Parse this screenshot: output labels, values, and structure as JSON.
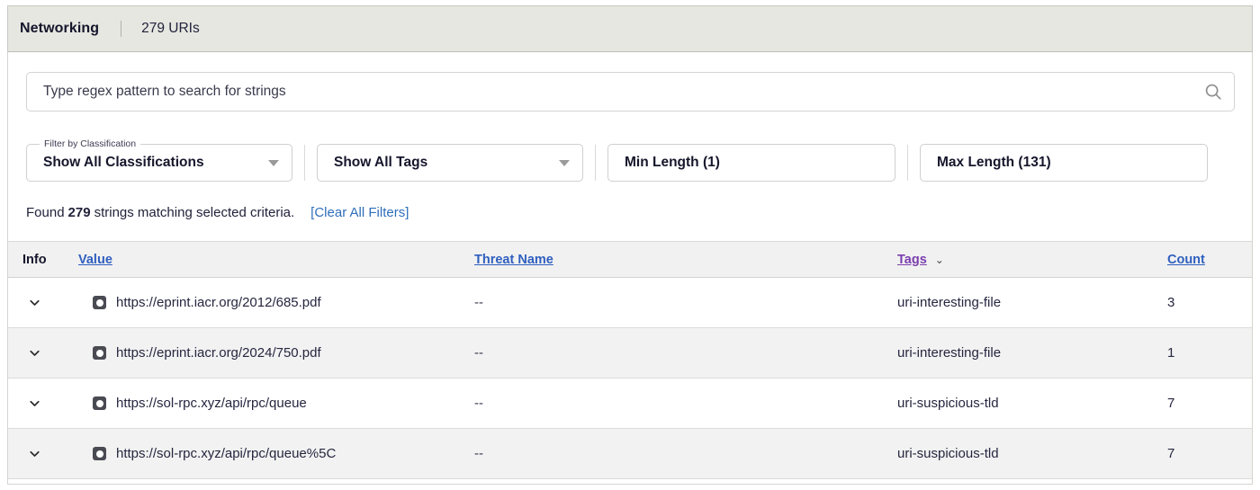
{
  "header": {
    "title": "Networking",
    "count_label": "279 URIs"
  },
  "search": {
    "placeholder": "Type regex pattern to search for strings",
    "value": "",
    "icon": "search-icon"
  },
  "filters": {
    "classification": {
      "floating_label": "Filter by Classification",
      "value": "Show All Classifications"
    },
    "tags": {
      "value": "Show All Tags"
    },
    "min_length": {
      "value": "Min Length (1)"
    },
    "max_length": {
      "value": "Max Length (131)"
    }
  },
  "summary": {
    "prefix": "Found",
    "count": "279",
    "suffix": "strings matching selected criteria.",
    "clear_filters": "[Clear All Filters]",
    "link_color": "#2f6fba"
  },
  "table": {
    "columns": {
      "info": "Info",
      "value": "Value",
      "threat_name": "Threat Name",
      "tags": "Tags",
      "count": "Count"
    },
    "sort": {
      "active_column": "Tags",
      "indicator": "⌄"
    },
    "rows": [
      {
        "expander": "chevron-down-icon",
        "classification_icon": "classification-dot-icon",
        "value": "https://eprint.iacr.org/2012/685.pdf",
        "threat_name": "--",
        "tags": "uri-interesting-file",
        "count": "3"
      },
      {
        "expander": "chevron-down-icon",
        "classification_icon": "classification-dot-icon",
        "value": "https://eprint.iacr.org/2024/750.pdf",
        "threat_name": "--",
        "tags": "uri-interesting-file",
        "count": "1"
      },
      {
        "expander": "chevron-down-icon",
        "classification_icon": "classification-dot-icon",
        "value": "https://sol-rpc.xyz/api/rpc/queue",
        "threat_name": "--",
        "tags": "uri-suspicious-tld",
        "count": "7"
      },
      {
        "expander": "chevron-down-icon",
        "classification_icon": "classification-dot-icon",
        "value": "https://sol-rpc.xyz/api/rpc/queue%5C",
        "threat_name": "--",
        "tags": "uri-suspicious-tld",
        "count": "7"
      }
    ]
  }
}
